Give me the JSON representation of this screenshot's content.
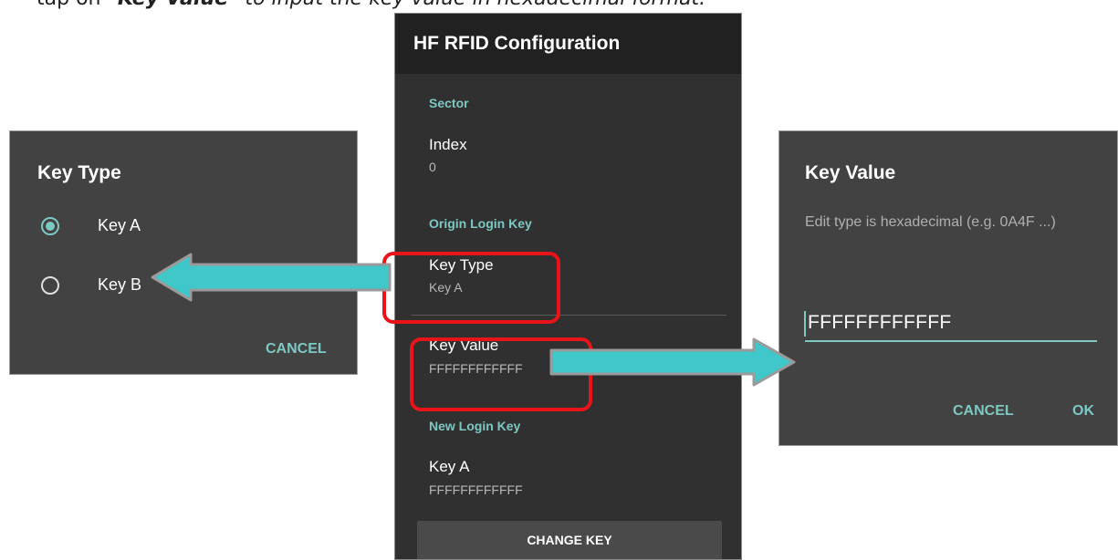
{
  "caption": {
    "prefix": "tap on ",
    "bold": "\"Key Value\"",
    "suffix": " to input the key value in hexadecimal format."
  },
  "screen": {
    "title": "HF RFID Configuration",
    "section_sector": "Sector",
    "index_title": "Index",
    "index_value": "0",
    "section_origin": "Origin Login Key",
    "key_type_title": "Key Type",
    "key_type_value": "Key A",
    "key_value_title": "Key Value",
    "key_value_value": "FFFFFFFFFFFF",
    "section_new": "New Login Key",
    "key_a_title": "Key A",
    "key_a_value": "FFFFFFFFFFFF",
    "change_key_button": "CHANGE KEY"
  },
  "key_type_dialog": {
    "title": "Key Type",
    "options": [
      {
        "label": "Key A",
        "checked": true
      },
      {
        "label": "Key B",
        "checked": false
      }
    ],
    "cancel": "CANCEL"
  },
  "key_value_dialog": {
    "title": "Key Value",
    "message": "Edit type is hexadecimal (e.g. 0A4F ...)",
    "input_value": "FFFFFFFFFFFF",
    "cancel": "CANCEL",
    "ok": "OK"
  },
  "colors": {
    "accent": "#7ec8c2",
    "highlight": "#e8141a",
    "arrow_fill": "#3fc7c9",
    "arrow_outline": "#9a9a9a"
  }
}
